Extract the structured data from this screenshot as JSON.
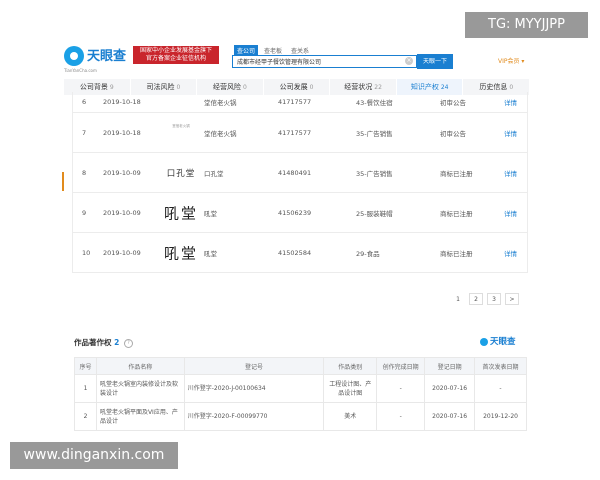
{
  "header": {
    "logo_text": "天眼查",
    "logo_sub": "TianYanCha.com",
    "banner_line1": "国家中小企业发展基金旗下",
    "banner_line2": "官方备案企业征信机构",
    "search_tabs": [
      "查公司",
      "查老板",
      "查关系"
    ],
    "search_value": "成都市经甲子餐饮管理有限公司",
    "search_button": "天眼一下",
    "vip_label": "VIP会员"
  },
  "tabs": [
    {
      "label": "公司背景",
      "count": "9"
    },
    {
      "label": "司法风险",
      "count": "0"
    },
    {
      "label": "经营风险",
      "count": "0"
    },
    {
      "label": "公司发展",
      "count": "0"
    },
    {
      "label": "经营状况",
      "count": "22"
    },
    {
      "label": "知识产权",
      "count": "24"
    },
    {
      "label": "历史信息",
      "count": "0"
    }
  ],
  "trademarks": [
    {
      "no": "6",
      "date": "2019-10-18",
      "image_text": "",
      "name": "堂倌老火锅",
      "reg": "41717577",
      "class": "43-餐饮住宿",
      "status": "初审公告",
      "detail": "详情"
    },
    {
      "no": "7",
      "date": "2019-10-18",
      "image_text": "堂倌老火锅",
      "name": "堂倌老火锅",
      "reg": "41717577",
      "class": "35-广告销售",
      "status": "初审公告",
      "detail": "详情"
    },
    {
      "no": "8",
      "date": "2019-10-09",
      "image_text": "口孔堂",
      "name": "口孔堂",
      "reg": "41480491",
      "class": "35-广告销售",
      "status": "商标已注册",
      "detail": "详情"
    },
    {
      "no": "9",
      "date": "2019-10-09",
      "image_text": "吼堂",
      "name": "吼堂",
      "reg": "41506239",
      "class": "25-服装鞋帽",
      "status": "商标已注册",
      "detail": "详情"
    },
    {
      "no": "10",
      "date": "2019-10-09",
      "image_text": "吼堂",
      "name": "吼堂",
      "reg": "41502584",
      "class": "29-食品",
      "status": "商标已注册",
      "detail": "详情"
    }
  ],
  "pagination": [
    "1",
    "2",
    "3",
    ">"
  ],
  "copyright": {
    "title": "作品著作权",
    "count": "2",
    "watermark": "天眼查",
    "headers": [
      "序号",
      "作品名称",
      "登记号",
      "作品类别",
      "创作完成日期",
      "登记日期",
      "首次发表日期"
    ],
    "rows": [
      {
        "no": "1",
        "name": "吼堂老火锅室内装修设计及软装设计",
        "reg": "川作登字-2020-J-00100634",
        "type": "工程设计图、产品设计图",
        "created": "-",
        "registered": "2020-07-16",
        "published": "-"
      },
      {
        "no": "2",
        "name": "吼堂老火锅平面及VI应用、产品设计",
        "reg": "川作登字-2020-F-00099770",
        "type": "美术",
        "created": "-",
        "registered": "2020-07-16",
        "published": "2019-12-20"
      }
    ]
  },
  "overlays": {
    "tg": "TG: MYYJJPP",
    "site": "www.dinganxin.com"
  }
}
